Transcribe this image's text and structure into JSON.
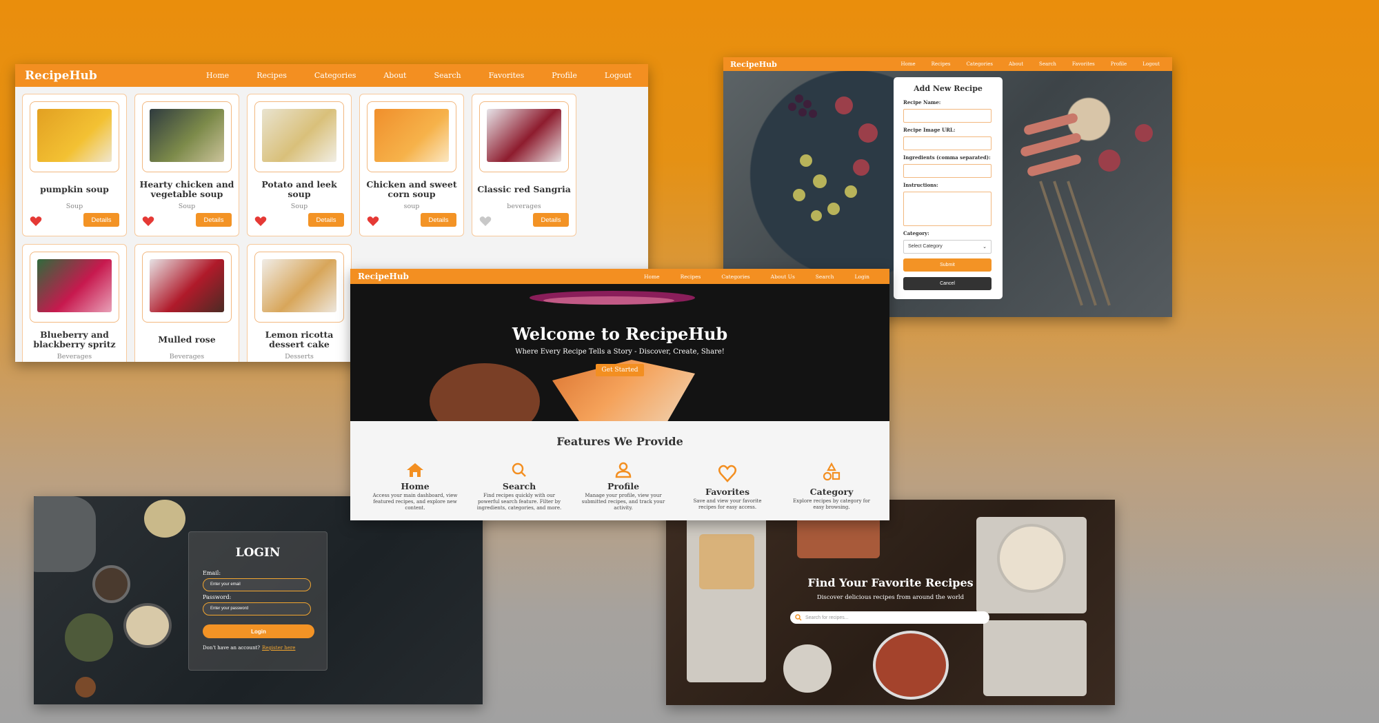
{
  "colors": {
    "accent": "#f38f21",
    "heart_active": "#e53935",
    "heart_inactive": "#c8c8c8"
  },
  "grid_page": {
    "brand": "RecipeHub",
    "nav": [
      "Home",
      "Recipes",
      "Categories",
      "About",
      "Search",
      "Favorites",
      "Profile",
      "Logout"
    ],
    "details_label": "Details",
    "cards": [
      {
        "title": "pumpkin soup",
        "category": "Soup",
        "favorite": true,
        "image": "pumpkin-soup"
      },
      {
        "title": "Hearty chicken and vegetable soup",
        "category": "Soup",
        "favorite": true,
        "image": "chicken-vegetable-soup"
      },
      {
        "title": "Potato and leek soup",
        "category": "Soup",
        "favorite": true,
        "image": "potato-leek-soup"
      },
      {
        "title": "Chicken and sweet corn soup",
        "category": "soup",
        "favorite": true,
        "image": "chicken-corn-soup"
      },
      {
        "title": "Classic red Sangria",
        "category": "beverages",
        "favorite": false,
        "image": "sangria"
      },
      {
        "title": "Blueberry and blackberry spritz",
        "category": "Beverages",
        "image": "berry-spritz"
      },
      {
        "title": "Mulled rose",
        "category": "Beverages",
        "image": "mulled-rose"
      },
      {
        "title": "Lemon ricotta dessert cake",
        "category": "Desserts",
        "image": "ricotta-cake"
      }
    ]
  },
  "add_page": {
    "brand": "RecipeHub",
    "nav": [
      "Home",
      "Recipes",
      "Categories",
      "About",
      "Search",
      "Favorites",
      "Profile",
      "Logout"
    ],
    "form": {
      "title": "Add New Recipe",
      "name_label": "Recipe Name:",
      "image_label": "Recipe Image URL:",
      "ingredients_label": "Ingredients (comma separated):",
      "instructions_label": "Instructions:",
      "category_label": "Category:",
      "category_value": "Select Category",
      "submit": "Submit",
      "cancel": "Cancel"
    }
  },
  "landing_page": {
    "brand": "RecipeHub",
    "nav": [
      "Home",
      "Recipes",
      "Categories",
      "About Us",
      "Search",
      "Login"
    ],
    "hero_title": "Welcome to RecipeHub",
    "hero_subtitle": "Where Every Recipe Tells a Story - Discover, Create, Share!",
    "hero_button": "Get Started",
    "features_title": "Features We Provide",
    "features": [
      {
        "icon": "home-icon",
        "name": "Home",
        "desc": "Access your main dashboard, view featured recipes, and explore new content."
      },
      {
        "icon": "search-icon",
        "name": "Search",
        "desc": "Find recipes quickly with our powerful search feature. Filter by ingredients, categories, and more."
      },
      {
        "icon": "user-icon",
        "name": "Profile",
        "desc": "Manage your profile, view your submitted recipes, and track your activity."
      },
      {
        "icon": "heart-icon",
        "name": "Favorites",
        "desc": "Save and view your favorite recipes for easy access."
      },
      {
        "icon": "shapes-icon",
        "name": "Category",
        "desc": "Explore recipes by category for easy browsing."
      }
    ]
  },
  "login_page": {
    "title": "LOGIN",
    "email_label": "Email:",
    "email_placeholder": "Enter your email",
    "password_label": "Password:",
    "password_placeholder": "Enter your password",
    "login_button": "Login",
    "register_prompt": "Don't have an account?",
    "register_link": "Register here"
  },
  "search_page": {
    "title": "Find Your Favorite Recipes",
    "subtitle": "Discover delicious recipes from around the world",
    "search_placeholder": "Search for recipes..."
  }
}
